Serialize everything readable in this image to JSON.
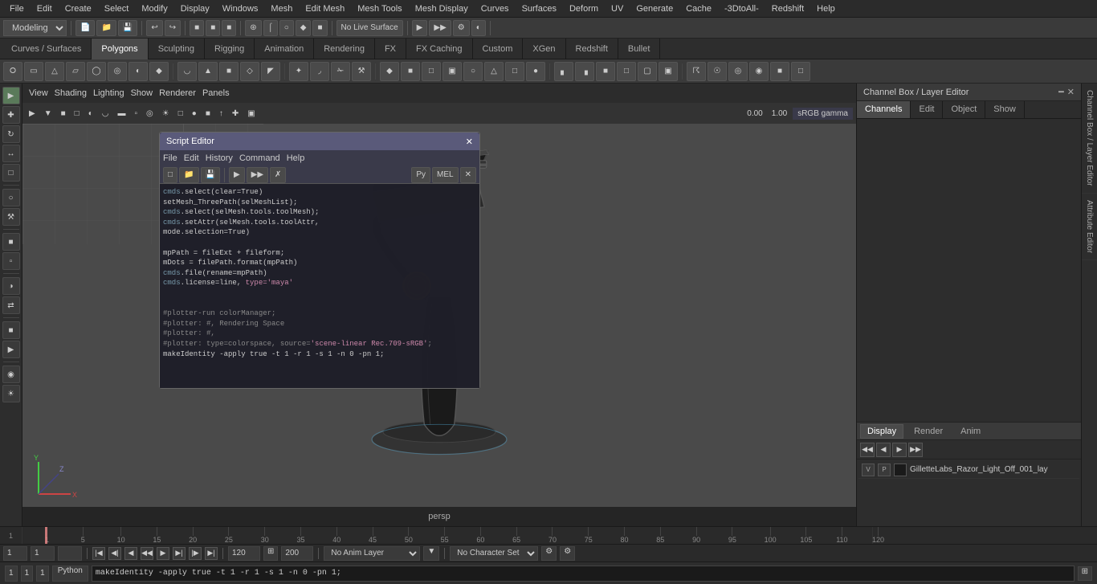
{
  "app": {
    "title": "Channel Box / Layer Editor"
  },
  "menu": {
    "items": [
      "File",
      "Edit",
      "Create",
      "Select",
      "Modify",
      "Display",
      "Windows",
      "Mesh",
      "Edit Mesh",
      "Mesh Tools",
      "Mesh Display",
      "Curves",
      "Surfaces",
      "Deform",
      "UV",
      "Generate",
      "Cache",
      "-3DtoAll-",
      "Redshift",
      "Help"
    ]
  },
  "toolbar1": {
    "workspace": "Modeling",
    "live_surface": "No Live Surface"
  },
  "workflow_tabs": {
    "tabs": [
      "Curves / Surfaces",
      "Polygons",
      "Sculpting",
      "Rigging",
      "Animation",
      "Rendering",
      "FX",
      "FX Caching",
      "Custom",
      "XGen",
      "Redshift",
      "Bullet"
    ],
    "active": "Polygons"
  },
  "viewport": {
    "menus": [
      "View",
      "Shading",
      "Lighting",
      "Show",
      "Renderer",
      "Panels"
    ],
    "camera": "persp",
    "gamma": "sRGB gamma",
    "coord_x": "0.00",
    "coord_y": "1.00"
  },
  "script_editor": {
    "title": "Script Editor",
    "menus": [
      "File",
      "Edit",
      "History",
      "Command",
      "Help"
    ],
    "code_lines": [
      "cmds.select(clear=True)",
      "setMesh_ThreePath(selMeshList);",
      "cmds.select(selMesh.tools.toolMesh);",
      "cmds.setAttr(selMesh.tools.toolAttr,",
      "mode.selection=True)",
      "",
      "mpPath = fileExt + fileform;",
      "mDots = filePath.format(mpPath)",
      "cmds.file(rename=mpPath)",
      "cmds.license=line, type='maya'",
      "",
      "",
      "#plotter-run colorManager;",
      "#plotter: #, Rendering Space",
      "#plotter: #,",
      "#plotter: type=colorspace, source='scene-linear Rec.709-sRGB';",
      "makeIdentity -apply true -t 1 -r 1 -s 1 -n 0 -pn 1;"
    ]
  },
  "right_panel": {
    "title": "Channel Box / Layer Editor",
    "tabs": [
      "Channels",
      "Edit",
      "Object",
      "Show"
    ],
    "layer_tabs": [
      "Display",
      "Render",
      "Anim"
    ],
    "active_layer_tab": "Display",
    "layers": [
      {
        "vis": "V",
        "pick": "P",
        "name": "GilletteLabs_Razor_Light_Off_001_lay"
      }
    ]
  },
  "timeline": {
    "ticks": [
      "1",
      "5",
      "10",
      "15",
      "20",
      "25",
      "30",
      "35",
      "40",
      "45",
      "50",
      "55",
      "60",
      "65",
      "70",
      "75",
      "80",
      "85",
      "90",
      "95",
      "100",
      "105",
      "110",
      "120"
    ],
    "current_frame": "1"
  },
  "render_controls": {
    "frame_start": "1",
    "frame_end": "1",
    "anim_layer": "No Anim Layer",
    "char_set": "No Character Set",
    "current_frame_input": "120",
    "end_frame": "200"
  },
  "status_bar": {
    "python_label": "Python",
    "command": "makeIdentity -apply true -t 1 -r 1 -s 1 -n 0 -pn 1;",
    "frame1": "1",
    "frame2": "1",
    "frame3": "1"
  },
  "vertical_tabs": {
    "channel_box": "Channel Box / Layer Editor",
    "attr_editor": "Attribute Editor"
  }
}
